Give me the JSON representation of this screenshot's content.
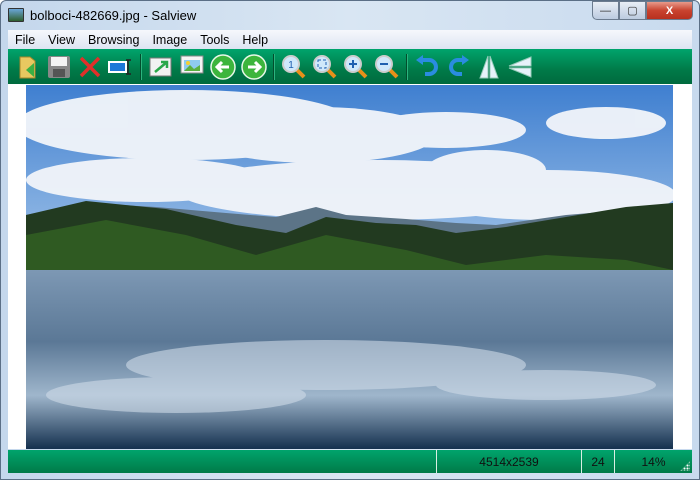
{
  "window": {
    "title": "bolboci-482669.jpg - Salview",
    "minimize": "—",
    "maximize": "▢",
    "close": "X"
  },
  "menu": [
    "File",
    "View",
    "Browsing",
    "Image",
    "Tools",
    "Help"
  ],
  "toolbar": {
    "buttons": [
      "open-folder",
      "save",
      "delete",
      "slideshow",
      "fullscreen",
      "set-wallpaper",
      "previous",
      "next",
      "zoom-actual",
      "zoom-fit",
      "zoom-in",
      "zoom-out",
      "rotate-left",
      "rotate-right",
      "flip-horizontal",
      "flip-vertical"
    ]
  },
  "status": {
    "left": "",
    "dimensions": "4514x2539",
    "bit_depth": "24",
    "zoom": "14%"
  },
  "colors": {
    "toolbar": "#00895a",
    "close": "#c9432f"
  }
}
